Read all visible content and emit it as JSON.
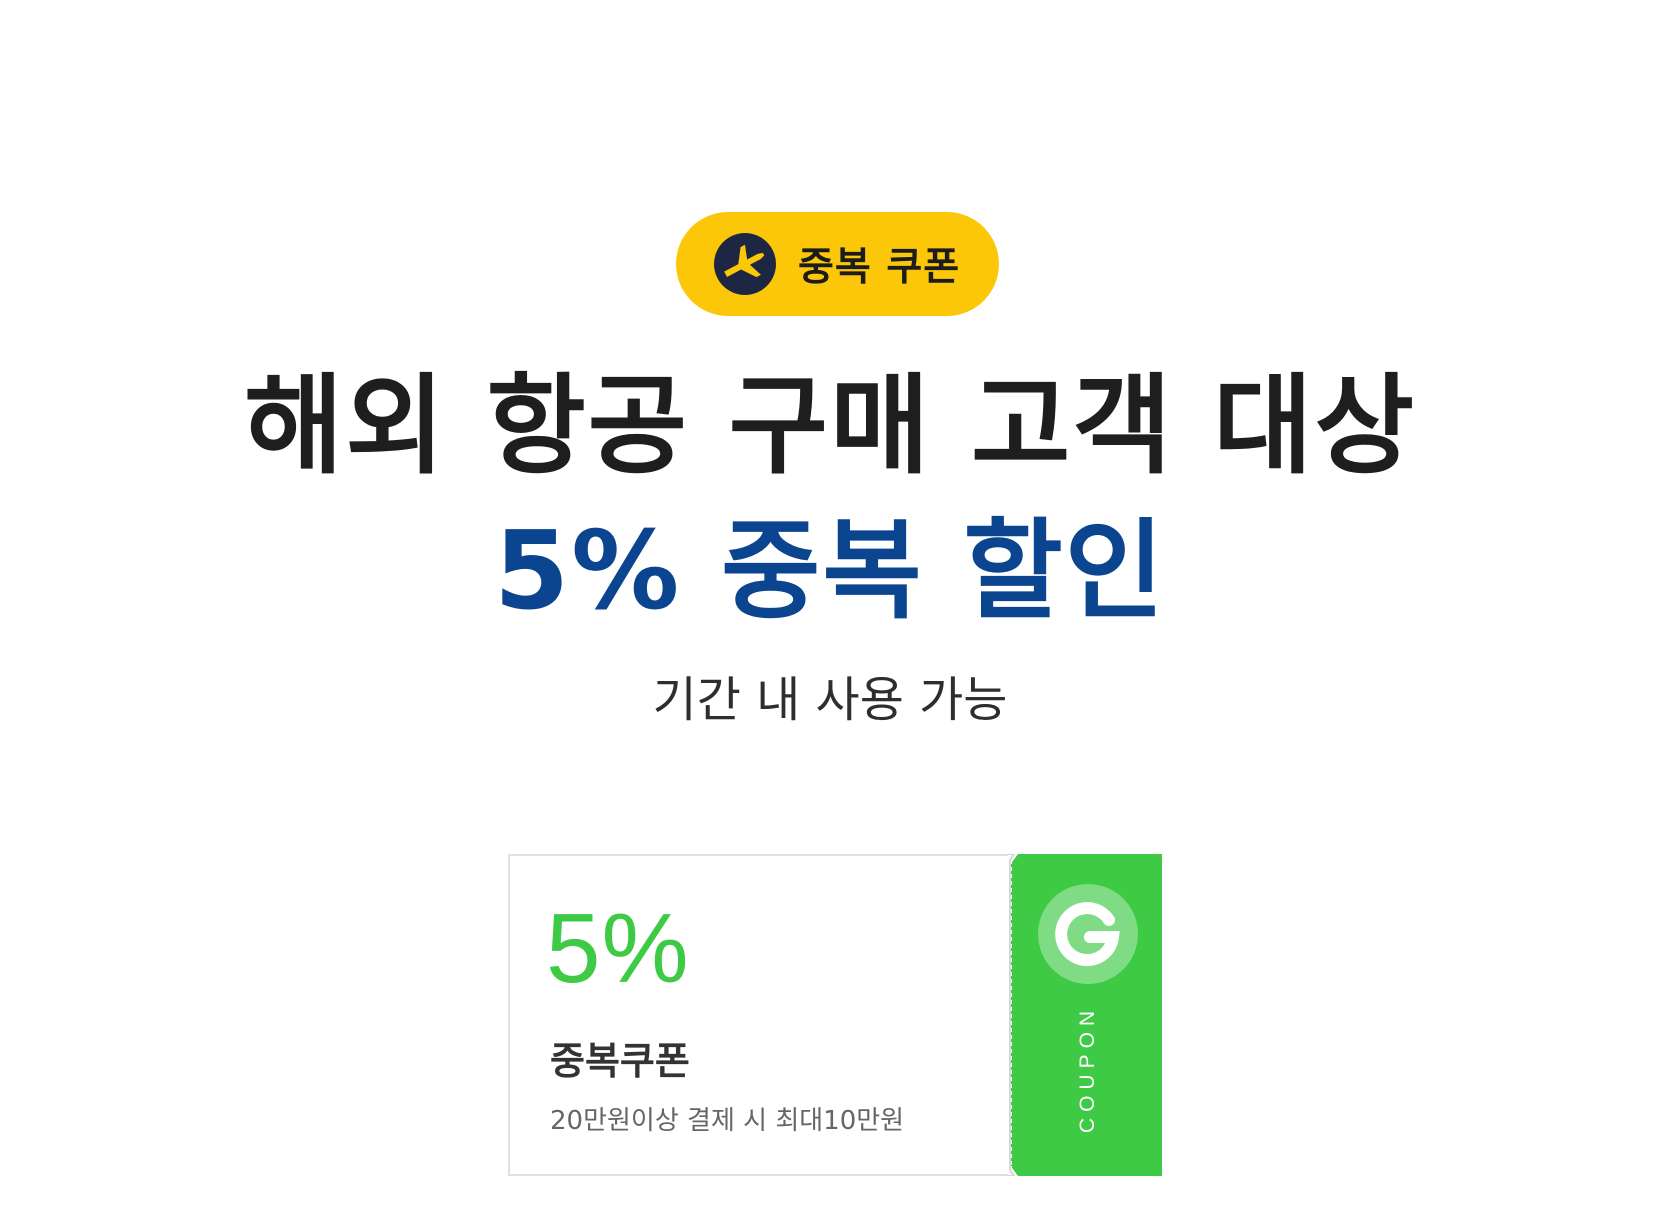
{
  "badge": {
    "label": "중복 쿠폰",
    "icon": "airplane-icon",
    "color": "#fcc708"
  },
  "headline": {
    "line1": "해외 항공 구매 고객 대상",
    "line2": "5% 중복 할인",
    "line2_color": "#0b4590"
  },
  "subtitle": "기간 내 사용 가능",
  "coupon": {
    "percent": "5%",
    "title": "중복쿠폰",
    "description": "20만원이상 결제 시 최대10만원",
    "stub_label": "COUPON",
    "stub_icon": "g-logo-icon",
    "accent_color": "#3fca46"
  }
}
